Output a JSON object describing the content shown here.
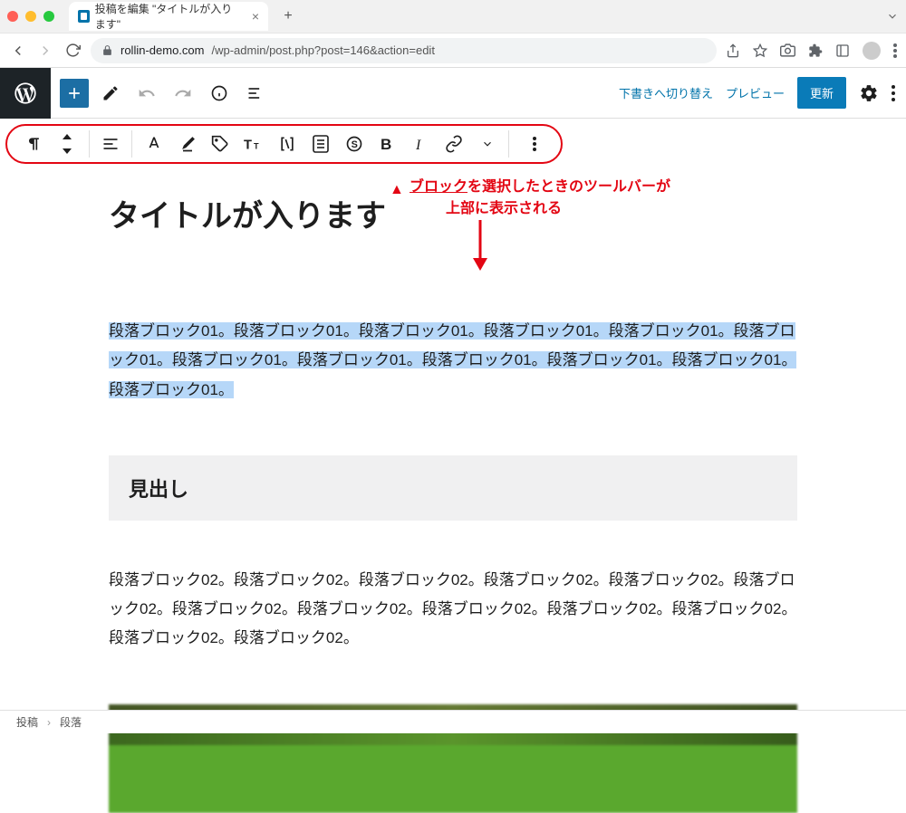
{
  "browser": {
    "tab_title": "投稿を編集 \"タイトルが入ります\"",
    "url_host": "rollin-demo.com",
    "url_path": "/wp-admin/post.php?post=146&action=edit"
  },
  "topbar": {
    "draft_switch": "下書きへ切り替え",
    "preview": "プレビュー",
    "update": "更新"
  },
  "annotation": {
    "line1_prefix": "ブロック",
    "line1_suffix": "を選択したときのツールバーが",
    "line2": "上部に表示される"
  },
  "post": {
    "title": "タイトルが入ります",
    "paragraph1": "段落ブロック01。段落ブロック01。段落ブロック01。段落ブロック01。段落ブロック01。段落ブロック01。段落ブロック01。段落ブロック01。段落ブロック01。段落ブロック01。段落ブロック01。段落ブロック01。",
    "heading": "見出し",
    "paragraph2": "段落ブロック02。段落ブロック02。段落ブロック02。段落ブロック02。段落ブロック02。段落ブロック02。段落ブロック02。段落ブロック02。段落ブロック02。段落ブロック02。段落ブロック02。段落ブロック02。段落ブロック02。"
  },
  "breadcrumb": {
    "root": "投稿",
    "current": "段落"
  }
}
